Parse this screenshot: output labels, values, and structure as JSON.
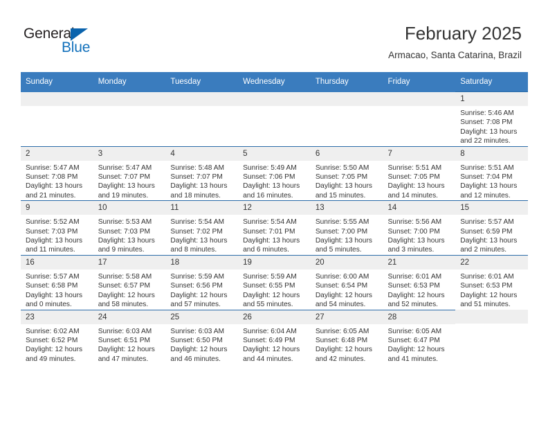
{
  "brand": {
    "name_part1": "General",
    "name_part2": "Blue",
    "triangle_icon": "triangle-icon",
    "colors": {
      "dark": "#231f20",
      "blue": "#1170bb",
      "header_blue": "#3a7cbe",
      "row_border_blue": "#2a6ba8",
      "daynum_band": "#efefef"
    }
  },
  "header": {
    "title": "February 2025",
    "subtitle": "Armacao, Santa Catarina, Brazil"
  },
  "calendar": {
    "weekday_headers": [
      "Sunday",
      "Monday",
      "Tuesday",
      "Wednesday",
      "Thursday",
      "Friday",
      "Saturday"
    ],
    "labels": {
      "sunrise_prefix": "Sunrise:",
      "sunset_prefix": "Sunset:",
      "daylight_prefix": "Daylight:"
    },
    "weeks": [
      [
        {
          "day": "",
          "sunrise": "",
          "sunset": "",
          "daylight_line1": "",
          "daylight_line2": "",
          "blank": true
        },
        {
          "day": "",
          "sunrise": "",
          "sunset": "",
          "daylight_line1": "",
          "daylight_line2": "",
          "blank": true
        },
        {
          "day": "",
          "sunrise": "",
          "sunset": "",
          "daylight_line1": "",
          "daylight_line2": "",
          "blank": true
        },
        {
          "day": "",
          "sunrise": "",
          "sunset": "",
          "daylight_line1": "",
          "daylight_line2": "",
          "blank": true
        },
        {
          "day": "",
          "sunrise": "",
          "sunset": "",
          "daylight_line1": "",
          "daylight_line2": "",
          "blank": true
        },
        {
          "day": "",
          "sunrise": "",
          "sunset": "",
          "daylight_line1": "",
          "daylight_line2": "",
          "blank": true
        },
        {
          "day": "1",
          "sunrise": "Sunrise: 5:46 AM",
          "sunset": "Sunset: 7:08 PM",
          "daylight_line1": "Daylight: 13 hours",
          "daylight_line2": "and 22 minutes.",
          "blank": false
        }
      ],
      [
        {
          "day": "2",
          "sunrise": "Sunrise: 5:47 AM",
          "sunset": "Sunset: 7:08 PM",
          "daylight_line1": "Daylight: 13 hours",
          "daylight_line2": "and 21 minutes.",
          "blank": false
        },
        {
          "day": "3",
          "sunrise": "Sunrise: 5:47 AM",
          "sunset": "Sunset: 7:07 PM",
          "daylight_line1": "Daylight: 13 hours",
          "daylight_line2": "and 19 minutes.",
          "blank": false
        },
        {
          "day": "4",
          "sunrise": "Sunrise: 5:48 AM",
          "sunset": "Sunset: 7:07 PM",
          "daylight_line1": "Daylight: 13 hours",
          "daylight_line2": "and 18 minutes.",
          "blank": false
        },
        {
          "day": "5",
          "sunrise": "Sunrise: 5:49 AM",
          "sunset": "Sunset: 7:06 PM",
          "daylight_line1": "Daylight: 13 hours",
          "daylight_line2": "and 16 minutes.",
          "blank": false
        },
        {
          "day": "6",
          "sunrise": "Sunrise: 5:50 AM",
          "sunset": "Sunset: 7:05 PM",
          "daylight_line1": "Daylight: 13 hours",
          "daylight_line2": "and 15 minutes.",
          "blank": false
        },
        {
          "day": "7",
          "sunrise": "Sunrise: 5:51 AM",
          "sunset": "Sunset: 7:05 PM",
          "daylight_line1": "Daylight: 13 hours",
          "daylight_line2": "and 14 minutes.",
          "blank": false
        },
        {
          "day": "8",
          "sunrise": "Sunrise: 5:51 AM",
          "sunset": "Sunset: 7:04 PM",
          "daylight_line1": "Daylight: 13 hours",
          "daylight_line2": "and 12 minutes.",
          "blank": false
        }
      ],
      [
        {
          "day": "9",
          "sunrise": "Sunrise: 5:52 AM",
          "sunset": "Sunset: 7:03 PM",
          "daylight_line1": "Daylight: 13 hours",
          "daylight_line2": "and 11 minutes.",
          "blank": false
        },
        {
          "day": "10",
          "sunrise": "Sunrise: 5:53 AM",
          "sunset": "Sunset: 7:03 PM",
          "daylight_line1": "Daylight: 13 hours",
          "daylight_line2": "and 9 minutes.",
          "blank": false
        },
        {
          "day": "11",
          "sunrise": "Sunrise: 5:54 AM",
          "sunset": "Sunset: 7:02 PM",
          "daylight_line1": "Daylight: 13 hours",
          "daylight_line2": "and 8 minutes.",
          "blank": false
        },
        {
          "day": "12",
          "sunrise": "Sunrise: 5:54 AM",
          "sunset": "Sunset: 7:01 PM",
          "daylight_line1": "Daylight: 13 hours",
          "daylight_line2": "and 6 minutes.",
          "blank": false
        },
        {
          "day": "13",
          "sunrise": "Sunrise: 5:55 AM",
          "sunset": "Sunset: 7:00 PM",
          "daylight_line1": "Daylight: 13 hours",
          "daylight_line2": "and 5 minutes.",
          "blank": false
        },
        {
          "day": "14",
          "sunrise": "Sunrise: 5:56 AM",
          "sunset": "Sunset: 7:00 PM",
          "daylight_line1": "Daylight: 13 hours",
          "daylight_line2": "and 3 minutes.",
          "blank": false
        },
        {
          "day": "15",
          "sunrise": "Sunrise: 5:57 AM",
          "sunset": "Sunset: 6:59 PM",
          "daylight_line1": "Daylight: 13 hours",
          "daylight_line2": "and 2 minutes.",
          "blank": false
        }
      ],
      [
        {
          "day": "16",
          "sunrise": "Sunrise: 5:57 AM",
          "sunset": "Sunset: 6:58 PM",
          "daylight_line1": "Daylight: 13 hours",
          "daylight_line2": "and 0 minutes.",
          "blank": false
        },
        {
          "day": "17",
          "sunrise": "Sunrise: 5:58 AM",
          "sunset": "Sunset: 6:57 PM",
          "daylight_line1": "Daylight: 12 hours",
          "daylight_line2": "and 58 minutes.",
          "blank": false
        },
        {
          "day": "18",
          "sunrise": "Sunrise: 5:59 AM",
          "sunset": "Sunset: 6:56 PM",
          "daylight_line1": "Daylight: 12 hours",
          "daylight_line2": "and 57 minutes.",
          "blank": false
        },
        {
          "day": "19",
          "sunrise": "Sunrise: 5:59 AM",
          "sunset": "Sunset: 6:55 PM",
          "daylight_line1": "Daylight: 12 hours",
          "daylight_line2": "and 55 minutes.",
          "blank": false
        },
        {
          "day": "20",
          "sunrise": "Sunrise: 6:00 AM",
          "sunset": "Sunset: 6:54 PM",
          "daylight_line1": "Daylight: 12 hours",
          "daylight_line2": "and 54 minutes.",
          "blank": false
        },
        {
          "day": "21",
          "sunrise": "Sunrise: 6:01 AM",
          "sunset": "Sunset: 6:53 PM",
          "daylight_line1": "Daylight: 12 hours",
          "daylight_line2": "and 52 minutes.",
          "blank": false
        },
        {
          "day": "22",
          "sunrise": "Sunrise: 6:01 AM",
          "sunset": "Sunset: 6:53 PM",
          "daylight_line1": "Daylight: 12 hours",
          "daylight_line2": "and 51 minutes.",
          "blank": false
        }
      ],
      [
        {
          "day": "23",
          "sunrise": "Sunrise: 6:02 AM",
          "sunset": "Sunset: 6:52 PM",
          "daylight_line1": "Daylight: 12 hours",
          "daylight_line2": "and 49 minutes.",
          "blank": false
        },
        {
          "day": "24",
          "sunrise": "Sunrise: 6:03 AM",
          "sunset": "Sunset: 6:51 PM",
          "daylight_line1": "Daylight: 12 hours",
          "daylight_line2": "and 47 minutes.",
          "blank": false
        },
        {
          "day": "25",
          "sunrise": "Sunrise: 6:03 AM",
          "sunset": "Sunset: 6:50 PM",
          "daylight_line1": "Daylight: 12 hours",
          "daylight_line2": "and 46 minutes.",
          "blank": false
        },
        {
          "day": "26",
          "sunrise": "Sunrise: 6:04 AM",
          "sunset": "Sunset: 6:49 PM",
          "daylight_line1": "Daylight: 12 hours",
          "daylight_line2": "and 44 minutes.",
          "blank": false
        },
        {
          "day": "27",
          "sunrise": "Sunrise: 6:05 AM",
          "sunset": "Sunset: 6:48 PM",
          "daylight_line1": "Daylight: 12 hours",
          "daylight_line2": "and 42 minutes.",
          "blank": false
        },
        {
          "day": "28",
          "sunrise": "Sunrise: 6:05 AM",
          "sunset": "Sunset: 6:47 PM",
          "daylight_line1": "Daylight: 12 hours",
          "daylight_line2": "and 41 minutes.",
          "blank": false
        },
        {
          "day": "",
          "sunrise": "",
          "sunset": "",
          "daylight_line1": "",
          "daylight_line2": "",
          "blank": true
        }
      ]
    ]
  }
}
